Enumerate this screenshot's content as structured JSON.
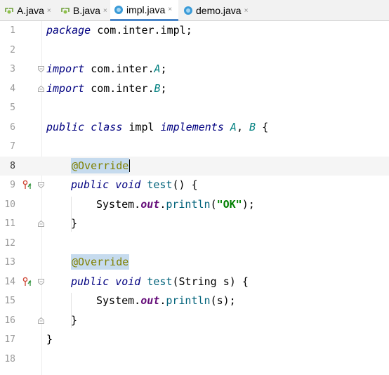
{
  "tabs": [
    {
      "label": "A.java",
      "close": "×",
      "icon": "interface-icon",
      "active": false
    },
    {
      "label": "B.java",
      "close": "×",
      "icon": "interface-icon",
      "active": false
    },
    {
      "label": "impl.java",
      "close": "×",
      "icon": "class-icon",
      "active": true
    },
    {
      "label": "demo.java",
      "close": "×",
      "icon": "class-icon",
      "active": false
    }
  ],
  "editor": {
    "line_numbers": [
      "1",
      "2",
      "3",
      "4",
      "5",
      "6",
      "7",
      "8",
      "9",
      "10",
      "11",
      "12",
      "13",
      "14",
      "15",
      "16",
      "17",
      "18"
    ],
    "current_line": "8",
    "l1": {
      "kw": "package",
      "pkg": "com.inter.impl",
      "semi": ";"
    },
    "l3": {
      "kw": "import",
      "pkg": "com.inter.",
      "name": "A",
      "semi": ";"
    },
    "l4": {
      "kw": "import",
      "pkg": "com.inter.",
      "name": "B",
      "semi": ";"
    },
    "l6": {
      "kw1": "public",
      "kw2": "class",
      "name": "impl",
      "kw3": "implements",
      "i1": "A",
      "comma": ",",
      "i2": "B",
      "brace": "{"
    },
    "l8": {
      "ann": "@Override"
    },
    "l9": {
      "kw1": "public",
      "kw2": "void",
      "fn": "test",
      "rest": "() {"
    },
    "l10": {
      "cls": "System.",
      "field": "out",
      "dot": ".",
      "fn": "println",
      "open": "(",
      "str": "\"OK\"",
      "close": ");"
    },
    "l11": {
      "brace": "}"
    },
    "l13": {
      "ann": "@Override"
    },
    "l14": {
      "kw1": "public",
      "kw2": "void",
      "fn": "test",
      "open": "(",
      "cls": "String",
      "rest": " s) {"
    },
    "l15": {
      "cls": "System.",
      "field": "out",
      "dot": ".",
      "fn": "println",
      "rest": "(s);"
    },
    "l16": {
      "brace": "}"
    },
    "l17": {
      "brace": "}"
    }
  },
  "colors": {
    "keyword": "#000080",
    "annotation": "#808000",
    "string": "#008000",
    "field": "#660e7a",
    "active_tab_underline": "#4a86c8"
  }
}
